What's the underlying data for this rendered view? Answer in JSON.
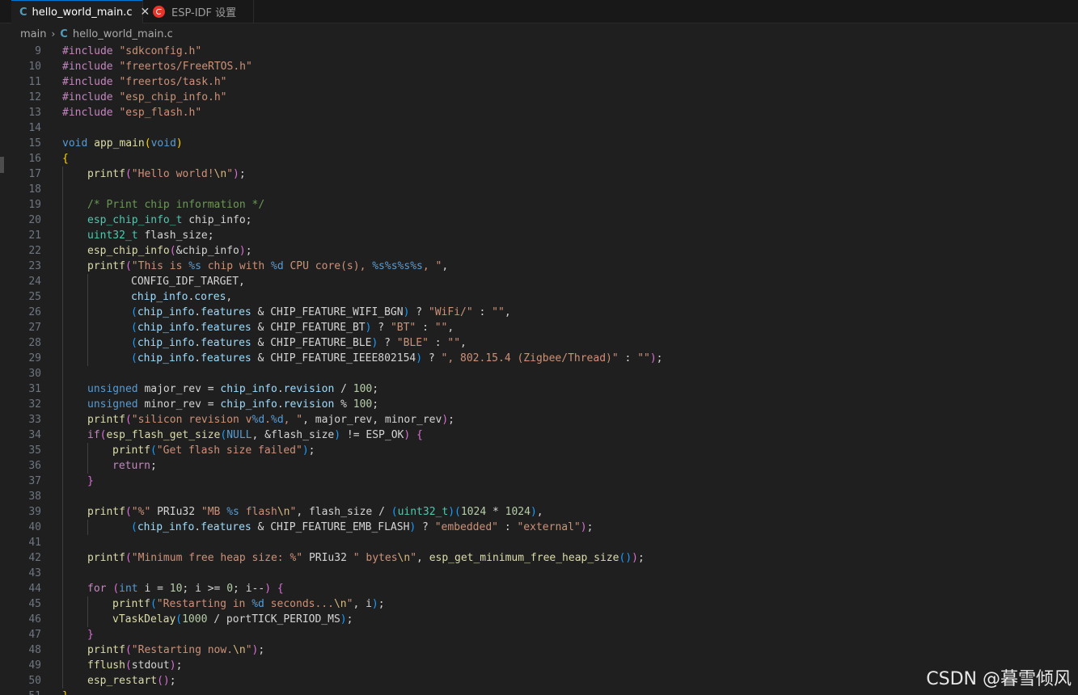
{
  "tabs": [
    {
      "icon": "c-file-icon",
      "label": "hello_world_main.c",
      "active": true
    },
    {
      "icon": "esp-idf-icon",
      "label": "ESP-IDF 设置",
      "active": false
    }
  ],
  "breadcrumb": {
    "folder": "main",
    "file": "hello_world_main.c"
  },
  "watermark": "CSDN @暮雪倾风",
  "colors": {
    "keyword": "#569cd6",
    "control": "#c586c0",
    "string": "#ce9178",
    "function": "#dcdcaa",
    "type": "#4ec9b0",
    "variable": "#9cdcfe",
    "number": "#b5cea8",
    "comment": "#6a9955",
    "escape": "#d7ba7d"
  },
  "code_lines": [
    {
      "n": "9",
      "indent": 0,
      "tokens": [
        [
          "c",
          "#include"
        ],
        [
          "p",
          " "
        ],
        [
          "s",
          "\"sdkconfig.h\""
        ]
      ]
    },
    {
      "n": "10",
      "indent": 0,
      "tokens": [
        [
          "c",
          "#include"
        ],
        [
          "p",
          " "
        ],
        [
          "s",
          "\"freertos/FreeRTOS.h\""
        ]
      ]
    },
    {
      "n": "11",
      "indent": 0,
      "tokens": [
        [
          "c",
          "#include"
        ],
        [
          "p",
          " "
        ],
        [
          "s",
          "\"freertos/task.h\""
        ]
      ]
    },
    {
      "n": "12",
      "indent": 0,
      "tokens": [
        [
          "c",
          "#include"
        ],
        [
          "p",
          " "
        ],
        [
          "s",
          "\"esp_chip_info.h\""
        ]
      ]
    },
    {
      "n": "13",
      "indent": 0,
      "tokens": [
        [
          "c",
          "#include"
        ],
        [
          "p",
          " "
        ],
        [
          "s",
          "\"esp_flash.h\""
        ]
      ]
    },
    {
      "n": "14",
      "indent": 0,
      "tokens": []
    },
    {
      "n": "15",
      "indent": 0,
      "tokens": [
        [
          "k",
          "void"
        ],
        [
          "p",
          " "
        ],
        [
          "f",
          "app_main"
        ],
        [
          "b1",
          "("
        ],
        [
          "k",
          "void"
        ],
        [
          "b1",
          ")"
        ]
      ]
    },
    {
      "n": "16",
      "indent": 0,
      "tokens": [
        [
          "b1",
          "{"
        ]
      ]
    },
    {
      "n": "17",
      "indent": 1,
      "tokens": [
        [
          "f",
          "printf"
        ],
        [
          "b2",
          "("
        ],
        [
          "s",
          "\"Hello world!"
        ],
        [
          "e",
          "\\n"
        ],
        [
          "s",
          "\""
        ],
        [
          "b2",
          ")"
        ],
        [
          "pl",
          ";"
        ]
      ]
    },
    {
      "n": "18",
      "indent": 1,
      "tokens": []
    },
    {
      "n": "19",
      "indent": 1,
      "tokens": [
        [
          "m",
          "/* Print chip information */"
        ]
      ]
    },
    {
      "n": "20",
      "indent": 1,
      "tokens": [
        [
          "t",
          "esp_chip_info_t"
        ],
        [
          "pl",
          " chip_info;"
        ]
      ]
    },
    {
      "n": "21",
      "indent": 1,
      "tokens": [
        [
          "t",
          "uint32_t"
        ],
        [
          "pl",
          " flash_size;"
        ]
      ]
    },
    {
      "n": "22",
      "indent": 1,
      "tokens": [
        [
          "f",
          "esp_chip_info"
        ],
        [
          "b2",
          "("
        ],
        [
          "pl",
          "&chip_info"
        ],
        [
          "b2",
          ")"
        ],
        [
          "pl",
          ";"
        ]
      ]
    },
    {
      "n": "23",
      "indent": 1,
      "tokens": [
        [
          "f",
          "printf"
        ],
        [
          "b2",
          "("
        ],
        [
          "s",
          "\"This is "
        ],
        [
          "k",
          "%s"
        ],
        [
          "s",
          " chip with "
        ],
        [
          "k",
          "%d"
        ],
        [
          "s",
          " CPU core(s), "
        ],
        [
          "k",
          "%s%s%s%s"
        ],
        [
          "s",
          ", \""
        ],
        [
          "pl",
          ","
        ]
      ]
    },
    {
      "n": "24",
      "indent": 3,
      "tokens": [
        [
          "pl",
          "CONFIG_IDF_TARGET,"
        ]
      ]
    },
    {
      "n": "25",
      "indent": 3,
      "tokens": [
        [
          "v",
          "chip_info"
        ],
        [
          "pl",
          "."
        ],
        [
          "v",
          "cores"
        ],
        [
          "pl",
          ","
        ]
      ]
    },
    {
      "n": "26",
      "indent": 3,
      "tokens": [
        [
          "b3",
          "("
        ],
        [
          "v",
          "chip_info"
        ],
        [
          "pl",
          "."
        ],
        [
          "v",
          "features"
        ],
        [
          "pl",
          " & CHIP_FEATURE_WIFI_BGN"
        ],
        [
          "b3",
          ")"
        ],
        [
          "pl",
          " ? "
        ],
        [
          "s",
          "\"WiFi/\""
        ],
        [
          "pl",
          " : "
        ],
        [
          "s",
          "\"\""
        ],
        [
          "pl",
          ","
        ]
      ]
    },
    {
      "n": "27",
      "indent": 3,
      "tokens": [
        [
          "b3",
          "("
        ],
        [
          "v",
          "chip_info"
        ],
        [
          "pl",
          "."
        ],
        [
          "v",
          "features"
        ],
        [
          "pl",
          " & CHIP_FEATURE_BT"
        ],
        [
          "b3",
          ")"
        ],
        [
          "pl",
          " ? "
        ],
        [
          "s",
          "\"BT\""
        ],
        [
          "pl",
          " : "
        ],
        [
          "s",
          "\"\""
        ],
        [
          "pl",
          ","
        ]
      ]
    },
    {
      "n": "28",
      "indent": 3,
      "tokens": [
        [
          "b3",
          "("
        ],
        [
          "v",
          "chip_info"
        ],
        [
          "pl",
          "."
        ],
        [
          "v",
          "features"
        ],
        [
          "pl",
          " & CHIP_FEATURE_BLE"
        ],
        [
          "b3",
          ")"
        ],
        [
          "pl",
          " ? "
        ],
        [
          "s",
          "\"BLE\""
        ],
        [
          "pl",
          " : "
        ],
        [
          "s",
          "\"\""
        ],
        [
          "pl",
          ","
        ]
      ]
    },
    {
      "n": "29",
      "indent": 3,
      "tokens": [
        [
          "b3",
          "("
        ],
        [
          "v",
          "chip_info"
        ],
        [
          "pl",
          "."
        ],
        [
          "v",
          "features"
        ],
        [
          "pl",
          " & CHIP_FEATURE_IEEE802154"
        ],
        [
          "b3",
          ")"
        ],
        [
          "pl",
          " ? "
        ],
        [
          "s",
          "\", 802.15.4 (Zigbee/Thread)\""
        ],
        [
          "pl",
          " : "
        ],
        [
          "s",
          "\"\""
        ],
        [
          "b2",
          ")"
        ],
        [
          "pl",
          ";"
        ]
      ]
    },
    {
      "n": "30",
      "indent": 1,
      "tokens": []
    },
    {
      "n": "31",
      "indent": 1,
      "tokens": [
        [
          "k",
          "unsigned"
        ],
        [
          "pl",
          " major_rev = "
        ],
        [
          "v",
          "chip_info"
        ],
        [
          "pl",
          "."
        ],
        [
          "v",
          "revision"
        ],
        [
          "pl",
          " / "
        ],
        [
          "n",
          "100"
        ],
        [
          "pl",
          ";"
        ]
      ]
    },
    {
      "n": "32",
      "indent": 1,
      "tokens": [
        [
          "k",
          "unsigned"
        ],
        [
          "pl",
          " minor_rev = "
        ],
        [
          "v",
          "chip_info"
        ],
        [
          "pl",
          "."
        ],
        [
          "v",
          "revision"
        ],
        [
          "pl",
          " % "
        ],
        [
          "n",
          "100"
        ],
        [
          "pl",
          ";"
        ]
      ]
    },
    {
      "n": "33",
      "indent": 1,
      "tokens": [
        [
          "f",
          "printf"
        ],
        [
          "b2",
          "("
        ],
        [
          "s",
          "\"silicon revision v"
        ],
        [
          "k",
          "%d"
        ],
        [
          "s",
          "."
        ],
        [
          "k",
          "%d"
        ],
        [
          "s",
          ", \""
        ],
        [
          "pl",
          ", major_rev, minor_rev"
        ],
        [
          "b2",
          ")"
        ],
        [
          "pl",
          ";"
        ]
      ]
    },
    {
      "n": "34",
      "indent": 1,
      "tokens": [
        [
          "c",
          "if"
        ],
        [
          "b2",
          "("
        ],
        [
          "f",
          "esp_flash_get_size"
        ],
        [
          "b3",
          "("
        ],
        [
          "k",
          "NULL"
        ],
        [
          "pl",
          ", &flash_size"
        ],
        [
          "b3",
          ")"
        ],
        [
          "pl",
          " != ESP_OK"
        ],
        [
          "b2",
          ")"
        ],
        [
          "pl",
          " "
        ],
        [
          "b2",
          "{"
        ]
      ]
    },
    {
      "n": "35",
      "indent": 2,
      "tokens": [
        [
          "f",
          "printf"
        ],
        [
          "b3",
          "("
        ],
        [
          "s",
          "\"Get flash size failed\""
        ],
        [
          "b3",
          ")"
        ],
        [
          "pl",
          ";"
        ]
      ]
    },
    {
      "n": "36",
      "indent": 2,
      "tokens": [
        [
          "c",
          "return"
        ],
        [
          "pl",
          ";"
        ]
      ]
    },
    {
      "n": "37",
      "indent": 1,
      "tokens": [
        [
          "b2",
          "}"
        ]
      ]
    },
    {
      "n": "38",
      "indent": 1,
      "tokens": []
    },
    {
      "n": "39",
      "indent": 1,
      "tokens": [
        [
          "f",
          "printf"
        ],
        [
          "b2",
          "("
        ],
        [
          "s",
          "\"%\""
        ],
        [
          "pl",
          " PRIu32 "
        ],
        [
          "s",
          "\"MB "
        ],
        [
          "k",
          "%s"
        ],
        [
          "s",
          " flash"
        ],
        [
          "e",
          "\\n"
        ],
        [
          "s",
          "\""
        ],
        [
          "pl",
          ", flash_size / "
        ],
        [
          "b3",
          "("
        ],
        [
          "t",
          "uint32_t"
        ],
        [
          "b3",
          ")"
        ],
        [
          "b3",
          "("
        ],
        [
          "n",
          "1024"
        ],
        [
          "pl",
          " * "
        ],
        [
          "n",
          "1024"
        ],
        [
          "b3",
          ")"
        ],
        [
          "pl",
          ","
        ]
      ]
    },
    {
      "n": "40",
      "indent": 3,
      "tokens": [
        [
          "b3",
          "("
        ],
        [
          "v",
          "chip_info"
        ],
        [
          "pl",
          "."
        ],
        [
          "v",
          "features"
        ],
        [
          "pl",
          " & CHIP_FEATURE_EMB_FLASH"
        ],
        [
          "b3",
          ")"
        ],
        [
          "pl",
          " ? "
        ],
        [
          "s",
          "\"embedded\""
        ],
        [
          "pl",
          " : "
        ],
        [
          "s",
          "\"external\""
        ],
        [
          "b2",
          ")"
        ],
        [
          "pl",
          ";"
        ]
      ]
    },
    {
      "n": "41",
      "indent": 1,
      "tokens": []
    },
    {
      "n": "42",
      "indent": 1,
      "tokens": [
        [
          "f",
          "printf"
        ],
        [
          "b2",
          "("
        ],
        [
          "s",
          "\"Minimum free heap size: %\""
        ],
        [
          "pl",
          " PRIu32 "
        ],
        [
          "s",
          "\" bytes"
        ],
        [
          "e",
          "\\n"
        ],
        [
          "s",
          "\""
        ],
        [
          "pl",
          ", "
        ],
        [
          "f",
          "esp_get_minimum_free_heap_size"
        ],
        [
          "b3",
          "()"
        ],
        [
          "b2",
          ")"
        ],
        [
          "pl",
          ";"
        ]
      ]
    },
    {
      "n": "43",
      "indent": 1,
      "tokens": []
    },
    {
      "n": "44",
      "indent": 1,
      "tokens": [
        [
          "c",
          "for"
        ],
        [
          "pl",
          " "
        ],
        [
          "b2",
          "("
        ],
        [
          "k",
          "int"
        ],
        [
          "pl",
          " i = "
        ],
        [
          "n",
          "10"
        ],
        [
          "pl",
          "; i >= "
        ],
        [
          "n",
          "0"
        ],
        [
          "pl",
          "; i--"
        ],
        [
          "b2",
          ")"
        ],
        [
          "pl",
          " "
        ],
        [
          "b2",
          "{"
        ]
      ]
    },
    {
      "n": "45",
      "indent": 2,
      "tokens": [
        [
          "f",
          "printf"
        ],
        [
          "b3",
          "("
        ],
        [
          "s",
          "\"Restarting in "
        ],
        [
          "k",
          "%d"
        ],
        [
          "s",
          " seconds..."
        ],
        [
          "e",
          "\\n"
        ],
        [
          "s",
          "\""
        ],
        [
          "pl",
          ", i"
        ],
        [
          "b3",
          ")"
        ],
        [
          "pl",
          ";"
        ]
      ]
    },
    {
      "n": "46",
      "indent": 2,
      "tokens": [
        [
          "f",
          "vTaskDelay"
        ],
        [
          "b3",
          "("
        ],
        [
          "n",
          "1000"
        ],
        [
          "pl",
          " / portTICK_PERIOD_MS"
        ],
        [
          "b3",
          ")"
        ],
        [
          "pl",
          ";"
        ]
      ]
    },
    {
      "n": "47",
      "indent": 1,
      "tokens": [
        [
          "b2",
          "}"
        ]
      ]
    },
    {
      "n": "48",
      "indent": 1,
      "tokens": [
        [
          "f",
          "printf"
        ],
        [
          "b2",
          "("
        ],
        [
          "s",
          "\"Restarting now."
        ],
        [
          "e",
          "\\n"
        ],
        [
          "s",
          "\""
        ],
        [
          "b2",
          ")"
        ],
        [
          "pl",
          ";"
        ]
      ]
    },
    {
      "n": "49",
      "indent": 1,
      "tokens": [
        [
          "f",
          "fflush"
        ],
        [
          "b2",
          "("
        ],
        [
          "pl",
          "stdout"
        ],
        [
          "b2",
          ")"
        ],
        [
          "pl",
          ";"
        ]
      ]
    },
    {
      "n": "50",
      "indent": 1,
      "tokens": [
        [
          "f",
          "esp_restart"
        ],
        [
          "b2",
          "()"
        ],
        [
          "pl",
          ";"
        ]
      ]
    },
    {
      "n": "51",
      "indent": 0,
      "tokens": [
        [
          "b1",
          "}"
        ]
      ]
    }
  ]
}
